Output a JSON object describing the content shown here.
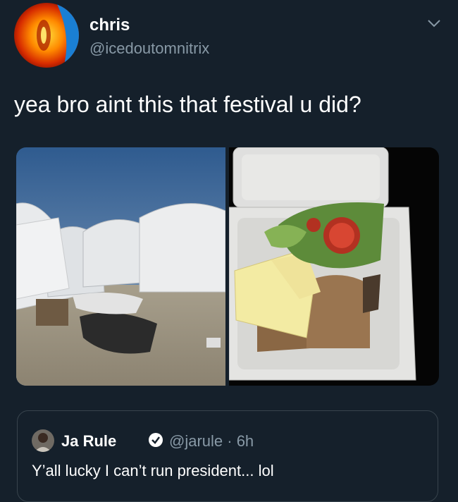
{
  "tweet": {
    "author": {
      "name": "chris",
      "handle": "@icedoutomnitrix"
    },
    "text": "yea bro aint this that festival u did?",
    "menu_icon": "chevron-down-icon",
    "media": [
      {
        "description": "festival-tents-photo"
      },
      {
        "description": "cheese-sandwich-box-photo"
      }
    ]
  },
  "quoted_tweet": {
    "name": "Ja Rule",
    "handle_time": "@jarule · 6h",
    "verified_icon": "verified-badge-icon",
    "text": "Y’all lucky I can’t run president... lol"
  },
  "colors": {
    "background": "#15202b",
    "secondary_text": "#8899a6",
    "border": "#38444d"
  }
}
